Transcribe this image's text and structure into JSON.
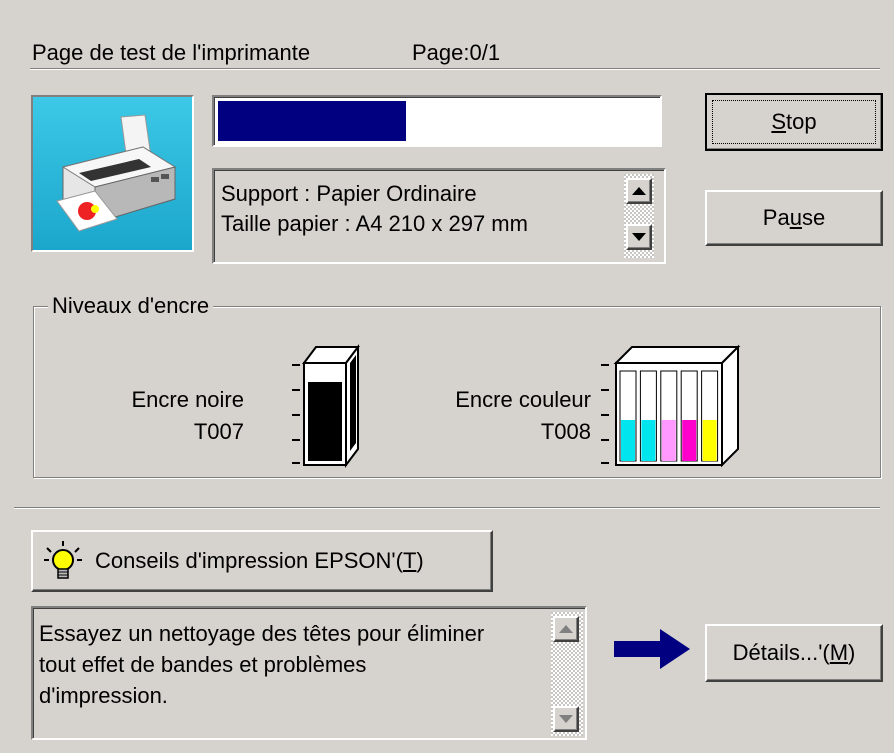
{
  "header": {
    "title": "Page de test de l'imprimante",
    "page_label": "Page:0/1"
  },
  "progress": {
    "fraction": 0.43,
    "color": "#000080"
  },
  "info_box": {
    "lines": [
      "Support : Papier Ordinaire",
      "Taille papier : A4 210 x 297 mm"
    ]
  },
  "buttons": {
    "stop": {
      "pre": "",
      "accel": "S",
      "post": "top"
    },
    "pause": {
      "pre": "Pa",
      "accel": "u",
      "post": "se"
    },
    "tips": {
      "pre": "Conseils d'impression EPSON'(",
      "accel": "T",
      "post": ")"
    },
    "details": {
      "pre": "Détails...'(",
      "accel": "M",
      "post": ")"
    }
  },
  "ink": {
    "group_title": "Niveaux d'encre",
    "black": {
      "name": "Encre noire",
      "code": "T007",
      "level": 0.82,
      "color": "#000000"
    },
    "color": {
      "name": "Encre couleur",
      "code": "T008",
      "slots": [
        {
          "color": "#00e5ee",
          "level": 0.46
        },
        {
          "color": "#00e5ee",
          "level": 0.46
        },
        {
          "color": "#ff99ff",
          "level": 0.46
        },
        {
          "color": "#ff00cc",
          "level": 0.46
        },
        {
          "color": "#ffff00",
          "level": 0.46
        }
      ]
    }
  },
  "tips_text": {
    "lines": [
      "Essayez un nettoyage des têtes pour éliminer",
      "tout effet de bandes et problèmes",
      "d'impression."
    ]
  },
  "icons": [
    "printer-icon",
    "lightbulb-icon",
    "arrow-right-icon",
    "ink-cartridge-black-icon",
    "ink-cartridge-color-icon"
  ]
}
